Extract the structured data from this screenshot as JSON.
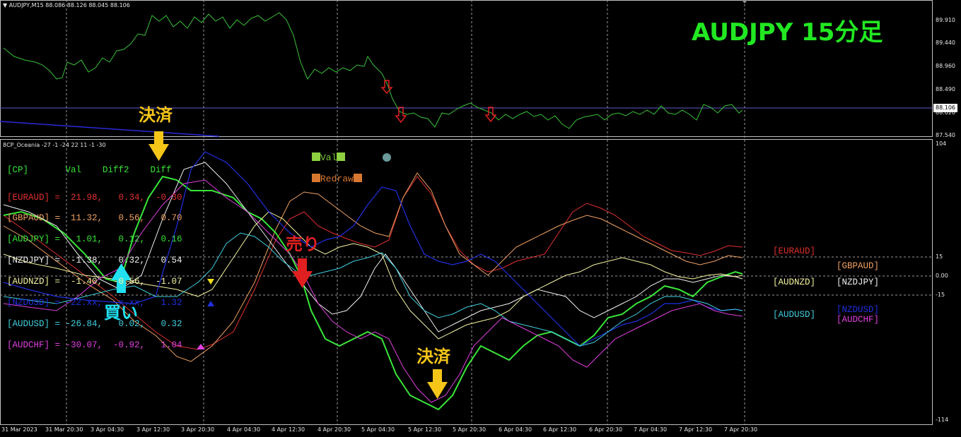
{
  "price_panel": {
    "header": "AUDJPY,M15  88.086 88.126 88.045 88.106",
    "title": "AUDJPY 15分足",
    "title_color": "#22e822",
    "price_labels": [
      "89.910",
      "89.440",
      "88.960",
      "88.490",
      "88.020",
      "87.540"
    ],
    "current_price": "88.106"
  },
  "indicator_panel": {
    "header": "8CP_Oceania -27 -1 -24 22 11 -1 -30",
    "axis_labels": {
      "top": "104",
      "upper": "15",
      "zero": "0.00",
      "lower": "-15",
      "bottom": "-114"
    },
    "buttons": {
      "val": "Val",
      "redraw": "Redraw"
    },
    "table_header": "[CP]       Val    Diff2    Diff",
    "rows": [
      {
        "text": "[EURAUD] =  21.98,   0.34,  -0.30",
        "color": "#e03030"
      },
      {
        "text": "[GBPAUD] =  11.32,   0.56,   0.70",
        "color": "#f0a060"
      },
      {
        "text": "[AUDJPY] =   1.01,   0.12,   0.16",
        "color": "#39e639"
      },
      {
        "text": "[NZDJPY] =  -1.38,   0.32,   0.54",
        "color": "#f0f0f0"
      },
      {
        "text": "[AUDNZD] =  -1.40,  -0.56,  -1.07",
        "color": "#f5f5a0"
      },
      {
        "text": "[NZDUSD] = -22.xx,  -x.xx,   1.32",
        "color": "#2030e0"
      },
      {
        "text": "[AUDUSD] = -26.84,   0.02,   0.32",
        "color": "#40d0e0"
      },
      {
        "text": "[AUDCHF] = -30.07,  -0.92,   1.04",
        "color": "#e040e0"
      }
    ],
    "right_labels": {
      "euraud": "[EURAUD]",
      "gbpaud": "[GBPAUD]",
      "audnzd": "[AUDNZD]",
      "nzdjpy": "[NZDJPY]",
      "audusd": "[AUDUSD]",
      "nzdusd": "[NZDUSD]",
      "audchf": "[AUDCHF]"
    }
  },
  "annotations": {
    "settle1": "決済",
    "buy": "買い",
    "sell": "売り",
    "settle2": "決済"
  },
  "time_axis": [
    "31 Mar 2023",
    "31 Mar 20:30",
    "3 Apr 04:30",
    "3 Apr 12:30",
    "3 Apr 20:30",
    "4 Apr 04:30",
    "4 Apr 12:30",
    "4 Apr 20:30",
    "5 Apr 04:30",
    "5 Apr 12:30",
    "5 Apr 20:30",
    "6 Apr 04:30",
    "6 Apr 12:30",
    "6 Apr 20:30",
    "7 Apr 04:30",
    "7 Apr 12:30",
    "7 Apr 20:30"
  ],
  "colors": {
    "grid": "#808080",
    "price_line": "#39c239",
    "sell_arrow": "#e02020",
    "buy_arrow": "#22e0f0",
    "settle_arrow": "#f5c518"
  }
}
